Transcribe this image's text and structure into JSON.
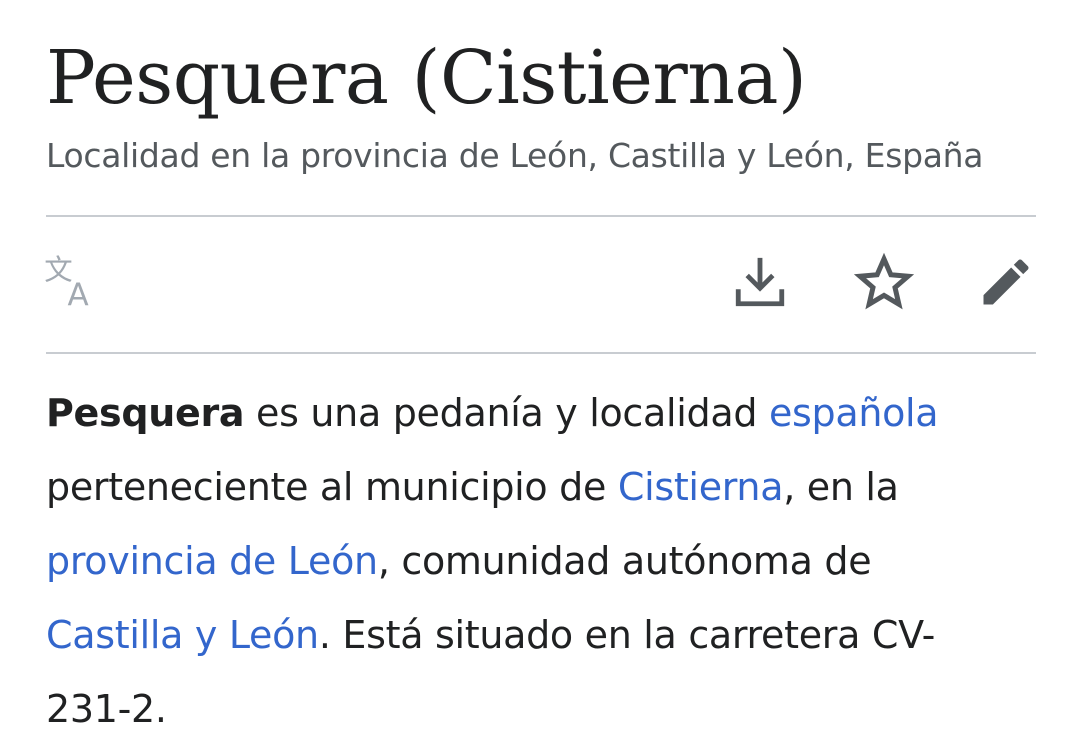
{
  "article": {
    "title": "Pesquera (Cistierna)",
    "description": "Localidad en la provincia de León, Castilla y León, España"
  },
  "actions": {
    "language_icon": "translate-icon",
    "download_icon": "download-icon",
    "watch_icon": "star-icon",
    "edit_icon": "pencil-icon"
  },
  "paragraph": {
    "line1": {
      "bold": "Pesquera",
      "text1": " es una pedanía y localidad ",
      "link1": "española"
    },
    "line2": {
      "text1": "perteneciente al municipio de ",
      "link1": "Cistierna",
      "text2": ", en la"
    },
    "line3": {
      "link1": "provincia de León",
      "text1": ", comunidad autónoma de"
    },
    "line4": {
      "link1": "Castilla y León",
      "text1": ". Está situado en la carretera CV-"
    },
    "line5": {
      "text1": "231-2."
    }
  },
  "colors": {
    "text": "#202122",
    "link": "#3366cc",
    "muted": "#54595d",
    "icon": "#54595d",
    "divider": "#c8ccd1"
  }
}
